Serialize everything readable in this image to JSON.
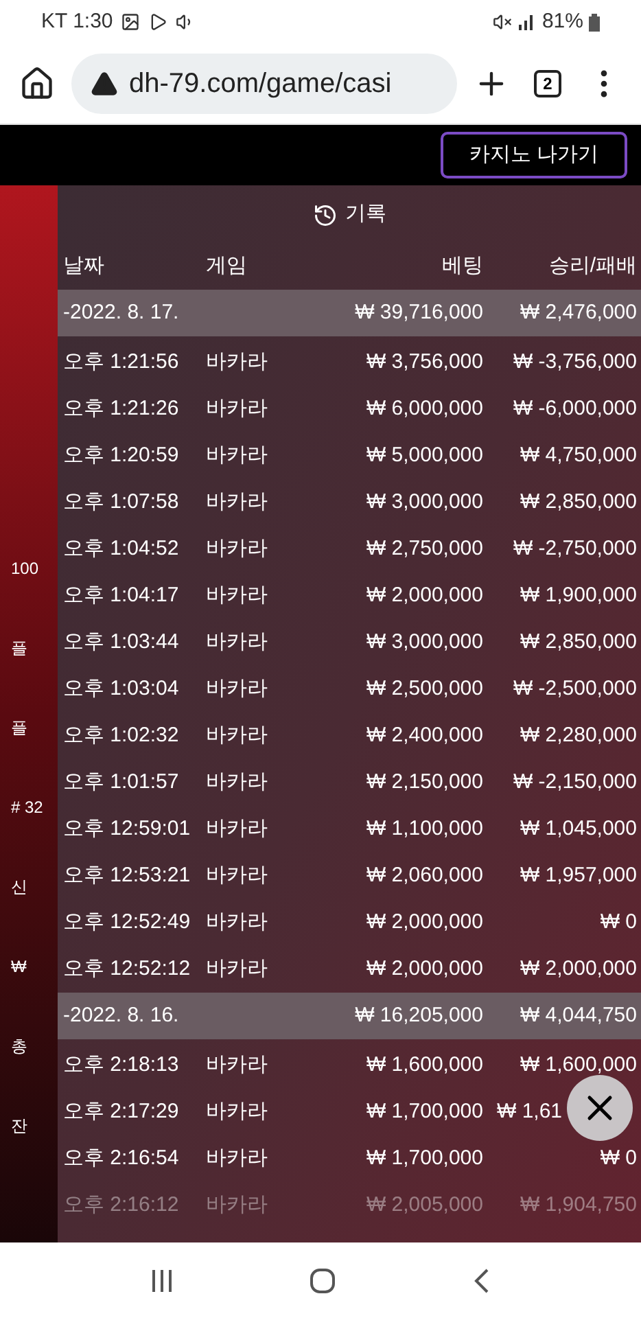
{
  "status_bar": {
    "carrier_time": "KT 1:30",
    "battery": "81%"
  },
  "browser": {
    "url": "dh-79.com/game/casi",
    "tab_count": "2"
  },
  "top_bar": {
    "exit_button": "카지노 나가기"
  },
  "background_game": {
    "texts": [
      "100",
      "플",
      "플",
      "# 32",
      "신",
      "₩",
      "총",
      "잔"
    ]
  },
  "history": {
    "title": "기록",
    "columns": [
      "날짜",
      "게임",
      "베팅",
      "승리/패배"
    ],
    "rows": [
      {
        "kind": "day",
        "date": "-2022. 8. 17.",
        "bet": "₩ 39,716,000",
        "result": "₩ 2,476,000",
        "faded": false
      },
      {
        "kind": "bet",
        "date": "오후 1:21:56",
        "game": "바카라",
        "bet": "₩ 3,756,000",
        "result": "₩ -3,756,000",
        "faded": false
      },
      {
        "kind": "bet",
        "date": "오후 1:21:26",
        "game": "바카라",
        "bet": "₩ 6,000,000",
        "result": "₩ -6,000,000",
        "faded": false
      },
      {
        "kind": "bet",
        "date": "오후 1:20:59",
        "game": "바카라",
        "bet": "₩ 5,000,000",
        "result": "₩ 4,750,000",
        "faded": false
      },
      {
        "kind": "bet",
        "date": "오후 1:07:58",
        "game": "바카라",
        "bet": "₩ 3,000,000",
        "result": "₩ 2,850,000",
        "faded": false
      },
      {
        "kind": "bet",
        "date": "오후 1:04:52",
        "game": "바카라",
        "bet": "₩ 2,750,000",
        "result": "₩ -2,750,000",
        "faded": false
      },
      {
        "kind": "bet",
        "date": "오후 1:04:17",
        "game": "바카라",
        "bet": "₩ 2,000,000",
        "result": "₩ 1,900,000",
        "faded": false
      },
      {
        "kind": "bet",
        "date": "오후 1:03:44",
        "game": "바카라",
        "bet": "₩ 3,000,000",
        "result": "₩ 2,850,000",
        "faded": false
      },
      {
        "kind": "bet",
        "date": "오후 1:03:04",
        "game": "바카라",
        "bet": "₩ 2,500,000",
        "result": "₩ -2,500,000",
        "faded": false
      },
      {
        "kind": "bet",
        "date": "오후 1:02:32",
        "game": "바카라",
        "bet": "₩ 2,400,000",
        "result": "₩ 2,280,000",
        "faded": false
      },
      {
        "kind": "bet",
        "date": "오후 1:01:57",
        "game": "바카라",
        "bet": "₩ 2,150,000",
        "result": "₩ -2,150,000",
        "faded": false
      },
      {
        "kind": "bet",
        "date": "오후 12:59:01",
        "game": "바카라",
        "bet": "₩ 1,100,000",
        "result": "₩ 1,045,000",
        "faded": false
      },
      {
        "kind": "bet",
        "date": "오후 12:53:21",
        "game": "바카라",
        "bet": "₩ 2,060,000",
        "result": "₩ 1,957,000",
        "faded": false
      },
      {
        "kind": "bet",
        "date": "오후 12:52:49",
        "game": "바카라",
        "bet": "₩ 2,000,000",
        "result": "₩ 0",
        "faded": false
      },
      {
        "kind": "bet",
        "date": "오후 12:52:12",
        "game": "바카라",
        "bet": "₩ 2,000,000",
        "result": "₩ 2,000,000",
        "faded": false
      },
      {
        "kind": "day",
        "date": "-2022. 8. 16.",
        "bet": "₩ 16,205,000",
        "result": "₩ 4,044,750",
        "faded": false
      },
      {
        "kind": "bet",
        "date": "오후 2:18:13",
        "game": "바카라",
        "bet": "₩ 1,600,000",
        "result": "₩ 1,600,000",
        "faded": false
      },
      {
        "kind": "bet",
        "date": "오후 2:17:29",
        "game": "바카라",
        "bet": "₩ 1,700,000",
        "result": "₩ 1,61",
        "faded": false,
        "covered": true
      },
      {
        "kind": "bet",
        "date": "오후 2:16:54",
        "game": "바카라",
        "bet": "₩ 1,700,000",
        "result": "₩ 0",
        "faded": false
      },
      {
        "kind": "bet",
        "date": "오후 2:16:12",
        "game": "바카라",
        "bet": "₩ 2,005,000",
        "result": "₩ 1,904,750",
        "faded": true
      }
    ]
  }
}
